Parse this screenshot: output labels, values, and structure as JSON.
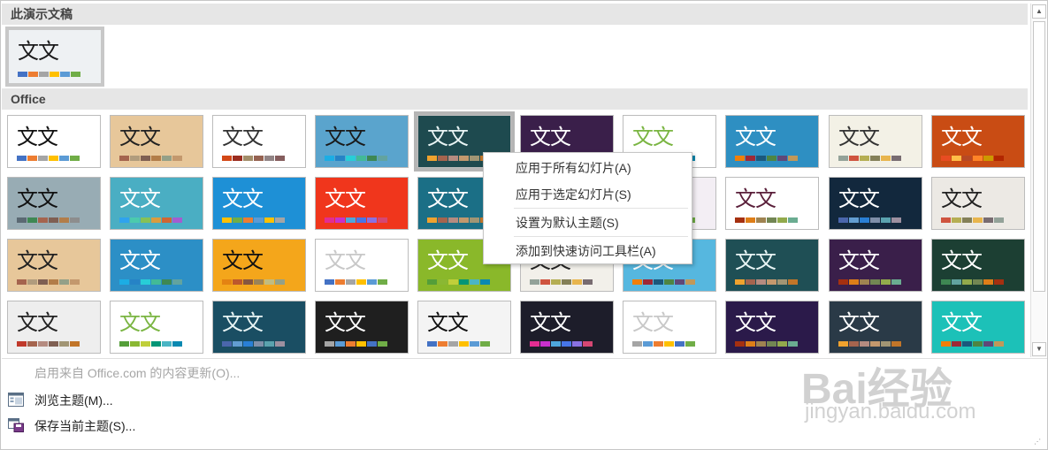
{
  "sections": {
    "current": "此演示文稿",
    "office": "Office"
  },
  "thumb_text": "文文",
  "current_theme": {
    "bg": "#eef1f3",
    "fg": "#1a1a1a",
    "swatches": [
      "#4472c4",
      "#ed7d31",
      "#a5a5a5",
      "#ffc000",
      "#5b9bd5",
      "#70ad47"
    ]
  },
  "themes": [
    {
      "bg": "#ffffff",
      "fg": "#111111",
      "swatches": [
        "#4472c4",
        "#ed7d31",
        "#a5a5a5",
        "#ffc000",
        "#5b9bd5",
        "#70ad47"
      ]
    },
    {
      "bg": "#e7c79a",
      "fg": "#222222",
      "swatches": [
        "#a5644e",
        "#b19c7d",
        "#7f5f52",
        "#b27d49",
        "#94a088",
        "#c3986d"
      ]
    },
    {
      "bg": "#ffffff",
      "fg": "#333333",
      "swatches": [
        "#d34817",
        "#9b2d1f",
        "#a28e6a",
        "#956251",
        "#918485",
        "#855d5d"
      ]
    },
    {
      "bg": "#5aa4cd",
      "fg": "#1a1a1a",
      "swatches": [
        "#1cade4",
        "#2683c6",
        "#27ced7",
        "#42ba97",
        "#3e8853",
        "#62a39f"
      ]
    },
    {
      "bg": "#1e4a4f",
      "fg": "#e8f4f4",
      "swatches": [
        "#f0a22e",
        "#a5644e",
        "#b58b80",
        "#c3986d",
        "#a19574",
        "#c17529"
      ]
    },
    {
      "bg": "#3a1f4a",
      "fg": "#ffffff",
      "swatches": [
        "#a53010",
        "#de7e18",
        "#9f8351",
        "#728653",
        "#92aa4c",
        "#6aac91"
      ]
    },
    {
      "bg": "#ffffff",
      "fg": "#7ab542",
      "swatches": [
        "#549e39",
        "#8ab833",
        "#c0cf3a",
        "#029676",
        "#4ab5c4",
        "#0989b1"
      ]
    },
    {
      "bg": "#2e8fc2",
      "fg": "#ffffff",
      "swatches": [
        "#f07f09",
        "#9f2936",
        "#1b587c",
        "#4e8542",
        "#604878",
        "#c19859"
      ]
    },
    {
      "bg": "#f3f1e6",
      "fg": "#333333",
      "swatches": [
        "#93a299",
        "#cf543f",
        "#b5ae53",
        "#848058",
        "#e8b54d",
        "#786c71"
      ]
    },
    {
      "bg": "#c94c14",
      "fg": "#ffffff",
      "swatches": [
        "#e84c22",
        "#ffbd47",
        "#b64926",
        "#ff8427",
        "#cc9900",
        "#b22600"
      ]
    },
    {
      "bg": "#98acb4",
      "fg": "#111111",
      "swatches": [
        "#5b6973",
        "#3e8853",
        "#a5644e",
        "#7f5f52",
        "#b27d49",
        "#8d8d8d"
      ]
    },
    {
      "bg": "#4aaec3",
      "fg": "#ffffff",
      "swatches": [
        "#2fa3ee",
        "#4bcaad",
        "#86c157",
        "#d99c3f",
        "#ce6633",
        "#a35dd1"
      ]
    },
    {
      "bg": "#1e90d6",
      "fg": "#ffffff",
      "swatches": [
        "#ffc000",
        "#70ad47",
        "#ed7d31",
        "#5b9bd5",
        "#ffc000",
        "#a5a5a5"
      ]
    },
    {
      "bg": "#f0361c",
      "fg": "#ffffff",
      "swatches": [
        "#e32d91",
        "#c830cc",
        "#4ea6dc",
        "#4775e7",
        "#8971e1",
        "#d54773"
      ]
    },
    {
      "bg": "#1b6f86",
      "fg": "#ffffff",
      "swatches": [
        "#f0a22e",
        "#a5644e",
        "#b58b80",
        "#c3986d",
        "#a19574",
        "#c17529"
      ]
    },
    {
      "bg": "#dedede",
      "fg": "#333333",
      "swatches": [
        "#a5a5a5",
        "#5b9bd5",
        "#ed7d31",
        "#ffc000",
        "#4472c4",
        "#70ad47"
      ]
    },
    {
      "bg": "#f3eef4",
      "fg": "#333333",
      "swatches": [
        "#3f3f3f",
        "#a5a5a5",
        "#5b9bd5",
        "#ed7d31",
        "#ffc000",
        "#70ad47"
      ]
    },
    {
      "bg": "#ffffff",
      "fg": "#5a1f3a",
      "swatches": [
        "#a53010",
        "#de7e18",
        "#9f8351",
        "#728653",
        "#92aa4c",
        "#6aac91"
      ]
    },
    {
      "bg": "#12283d",
      "fg": "#ffffff",
      "swatches": [
        "#4a66ac",
        "#629dd1",
        "#297fd5",
        "#7f8fa9",
        "#5aa2ae",
        "#9d90a0"
      ]
    },
    {
      "bg": "#ece9e4",
      "fg": "#222222",
      "swatches": [
        "#cf543f",
        "#b5ae53",
        "#848058",
        "#e8b54d",
        "#786c71",
        "#93a299"
      ]
    },
    {
      "bg": "#e7c79a",
      "fg": "#222222",
      "swatches": [
        "#a5644e",
        "#b19c7d",
        "#7f5f52",
        "#b27d49",
        "#94a088",
        "#c3986d"
      ]
    },
    {
      "bg": "#2c8fc6",
      "fg": "#ffffff",
      "swatches": [
        "#1cade4",
        "#2683c6",
        "#27ced7",
        "#42ba97",
        "#3e8853",
        "#62a39f"
      ]
    },
    {
      "bg": "#f4a61b",
      "fg": "#111111",
      "swatches": [
        "#e48312",
        "#bd582c",
        "#865640",
        "#9b8357",
        "#c2bc80",
        "#94a088"
      ]
    },
    {
      "bg": "#ffffff",
      "fg": "#c8c8c8",
      "swatches": [
        "#4472c4",
        "#ed7d31",
        "#a5a5a5",
        "#ffc000",
        "#5b9bd5",
        "#70ad47"
      ]
    },
    {
      "bg": "#8ab82a",
      "fg": "#ffffff",
      "swatches": [
        "#549e39",
        "#8ab833",
        "#c0cf3a",
        "#029676",
        "#4ab5c4",
        "#0989b1"
      ]
    },
    {
      "bg": "#f2f0ea",
      "fg": "#222222",
      "swatches": [
        "#93a299",
        "#cf543f",
        "#b5ae53",
        "#848058",
        "#e8b54d",
        "#786c71"
      ]
    },
    {
      "bg": "#56b7df",
      "fg": "#ffffff",
      "swatches": [
        "#f07f09",
        "#9f2936",
        "#1b587c",
        "#4e8542",
        "#604878",
        "#c19859"
      ]
    },
    {
      "bg": "#1f4f55",
      "fg": "#e8f4f4",
      "swatches": [
        "#f0a22e",
        "#a5644e",
        "#b58b80",
        "#c3986d",
        "#a19574",
        "#c17529"
      ]
    },
    {
      "bg": "#3a1f4a",
      "fg": "#ffffff",
      "swatches": [
        "#a53010",
        "#de7e18",
        "#9f8351",
        "#728653",
        "#92aa4c",
        "#6aac91"
      ]
    },
    {
      "bg": "#1c3f33",
      "fg": "#ffffff",
      "swatches": [
        "#3e8853",
        "#62a39f",
        "#92aa4c",
        "#728653",
        "#de7e18",
        "#a53010"
      ]
    },
    {
      "bg": "#eeeeee",
      "fg": "#222222",
      "swatches": [
        "#c0392b",
        "#a5644e",
        "#b58b80",
        "#7f5f52",
        "#a19574",
        "#c17529"
      ]
    },
    {
      "bg": "#ffffff",
      "fg": "#7ab542",
      "swatches": [
        "#549e39",
        "#8ab833",
        "#c0cf3a",
        "#029676",
        "#4ab5c4",
        "#0989b1"
      ]
    },
    {
      "bg": "#1a4e63",
      "fg": "#e8f4f4",
      "swatches": [
        "#4a66ac",
        "#629dd1",
        "#297fd5",
        "#7f8fa9",
        "#5aa2ae",
        "#9d90a0"
      ]
    },
    {
      "bg": "#1f1f1f",
      "fg": "#ffffff",
      "swatches": [
        "#a5a5a5",
        "#5b9bd5",
        "#ed7d31",
        "#ffc000",
        "#4472c4",
        "#70ad47"
      ]
    },
    {
      "bg": "#f4f4f4",
      "fg": "#111111",
      "swatches": [
        "#4472c4",
        "#ed7d31",
        "#a5a5a5",
        "#ffc000",
        "#5b9bd5",
        "#70ad47"
      ]
    },
    {
      "bg": "#1d1d2a",
      "fg": "#ffffff",
      "swatches": [
        "#e32d91",
        "#c830cc",
        "#4ea6dc",
        "#4775e7",
        "#8971e1",
        "#d54773"
      ]
    },
    {
      "bg": "#ffffff",
      "fg": "#c8c8c8",
      "swatches": [
        "#a5a5a5",
        "#5b9bd5",
        "#ed7d31",
        "#ffc000",
        "#4472c4",
        "#70ad47"
      ]
    },
    {
      "bg": "#2b1a4a",
      "fg": "#ffffff",
      "swatches": [
        "#a53010",
        "#de7e18",
        "#9f8351",
        "#728653",
        "#92aa4c",
        "#6aac91"
      ]
    },
    {
      "bg": "#2a3a47",
      "fg": "#ffffff",
      "swatches": [
        "#f0a22e",
        "#a5644e",
        "#b58b80",
        "#c3986d",
        "#a19574",
        "#c17529"
      ]
    },
    {
      "bg": "#1cc1b8",
      "fg": "#ffffff",
      "swatches": [
        "#f07f09",
        "#9f2936",
        "#1b587c",
        "#4e8542",
        "#604878",
        "#c19859"
      ]
    }
  ],
  "context_menu": {
    "items": [
      "应用于所有幻灯片(A)",
      "应用于选定幻灯片(S)",
      "设置为默认主题(S)",
      "添加到快速访问工具栏(A)"
    ]
  },
  "footer": {
    "enable_updates": "启用来自 Office.com 的内容更新(O)...",
    "browse": "浏览主题(M)...",
    "save": "保存当前主题(S)..."
  },
  "watermark": {
    "big": "Bai经验",
    "small": "jingyan.baidu.com"
  },
  "icons": {
    "scroll_up": "scroll-up-icon",
    "scroll_down": "scroll-down-icon",
    "browse": "browse-themes-icon",
    "save": "save-theme-icon",
    "grip": "resize-grip-icon"
  }
}
